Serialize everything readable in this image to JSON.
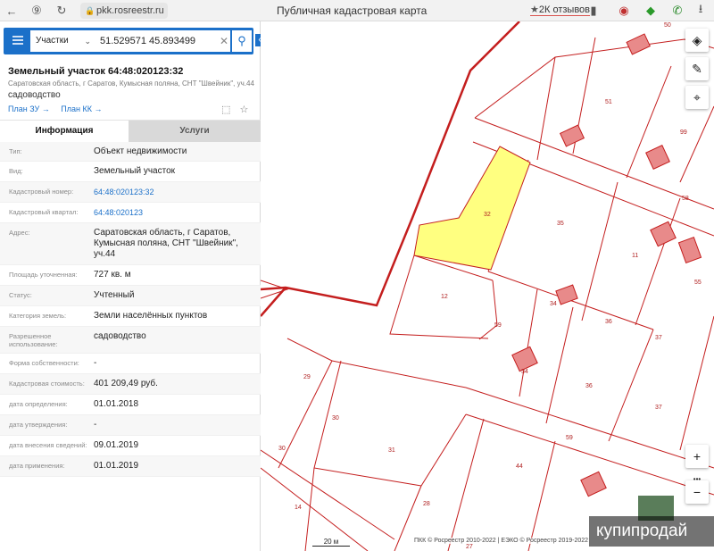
{
  "browser": {
    "url": "pkk.rosreestr.ru",
    "page_title": "Публичная кадастровая карта",
    "reviews": "2К отзывов"
  },
  "search": {
    "type_label": "Участки",
    "query": "51.529571 45.893499"
  },
  "object": {
    "title": "Земельный участок 64:48:020123:32",
    "address": "Саратовская область, г Саратов, Кумысная поляна, СНТ \"Швейник\", уч.44",
    "type": "садоводство",
    "link_plan_zu": "План ЗУ →",
    "link_plan_kk": "План КК →"
  },
  "tabs": {
    "info": "Информация",
    "services": "Услуги"
  },
  "rows": [
    {
      "label": "Тип:",
      "value": "Объект недвижимости",
      "h": 22
    },
    {
      "label": "Вид:",
      "value": "Земельный участок",
      "h": 23
    },
    {
      "label": "Кадастровый номер:",
      "value": "64:48:020123:32",
      "link": true,
      "h": 23
    },
    {
      "label": "Кадастровый квартал:",
      "value": "64:48:020123",
      "link": true,
      "h": 23
    },
    {
      "label": "Адрес:",
      "value": "Саратовская область, г Саратов, Кумысная поляна, СНТ \"Швейник\", уч.44",
      "h": 47
    },
    {
      "label": "Площадь уточненная:",
      "value": "727 кв. м",
      "h": 23
    },
    {
      "label": "Статус:",
      "value": "Учтенный",
      "h": 23
    },
    {
      "label": "Категория земель:",
      "value": "Земли населённых пунктов",
      "h": 23
    },
    {
      "label": "Разрешенное использование:",
      "value": "садоводство",
      "h": 30
    },
    {
      "label": "Форма собственности:",
      "value": "-",
      "h": 23
    },
    {
      "label": "Кадастровая стоимость:",
      "value": "401 209,49 руб.",
      "h": 23
    },
    {
      "label": "дата определения:",
      "value": "01.01.2018",
      "h": 23
    },
    {
      "label": "дата утверждения:",
      "value": "-",
      "h": 23
    },
    {
      "label": "дата внесения сведений:",
      "value": "09.01.2019",
      "h": 23
    },
    {
      "label": "дата применения:",
      "value": "01.01.2019",
      "h": 23
    }
  ],
  "map": {
    "parcel_labels": [
      "50",
      "51",
      "99",
      "58",
      "35",
      "32",
      "11",
      "55",
      "12",
      "34",
      "59",
      "36",
      "37",
      "29",
      "30",
      "31",
      "28",
      "44",
      "59",
      "36",
      "37",
      "34",
      "30",
      "14",
      "27"
    ],
    "scale": "20 м",
    "copyright": "ПКК © Росреестр 2010-2022 | ЕЭКО © Росреестр 2019-2022",
    "zoom_in": "+",
    "zoom_out": "−",
    "more": "•••"
  },
  "watermark": "купипродай",
  "colors": {
    "selected_parcel": "#ffff80",
    "boundary": "#c41e1e",
    "accent": "#1b70c9"
  }
}
